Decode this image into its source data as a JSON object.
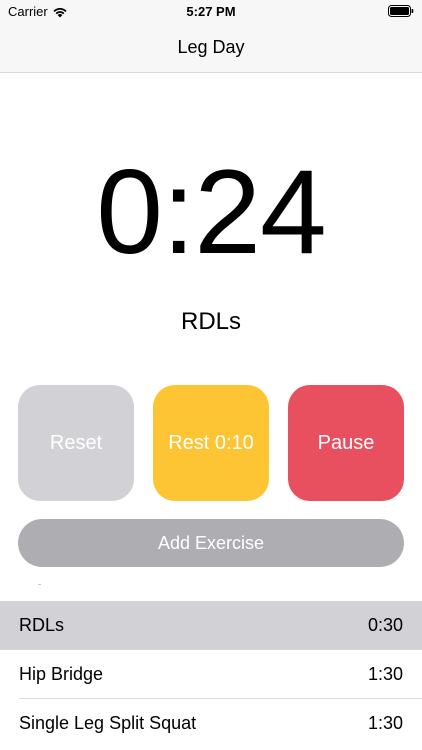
{
  "status_bar": {
    "carrier": "Carrier",
    "time": "5:27 PM"
  },
  "nav": {
    "title": "Leg Day"
  },
  "timer": {
    "display": "0:24",
    "current_exercise": "RDLs"
  },
  "buttons": {
    "reset_label": "Reset",
    "rest_label": "Rest 0:10",
    "pause_label": "Pause",
    "add_exercise_label": "Add Exercise"
  },
  "exercises": [
    {
      "name": "RDLs",
      "duration": "0:30",
      "selected": true
    },
    {
      "name": "Hip Bridge",
      "duration": "1:30",
      "selected": false
    },
    {
      "name": "Single Leg Split Squat",
      "duration": "1:30",
      "selected": false
    }
  ],
  "colors": {
    "reset": "#d1d1d6",
    "rest": "#fdc534",
    "pause": "#e8505f",
    "add": "#aeaeb2",
    "selected_row": "#d1d1d6"
  },
  "icons": [
    "wifi-icon",
    "battery-icon"
  ]
}
